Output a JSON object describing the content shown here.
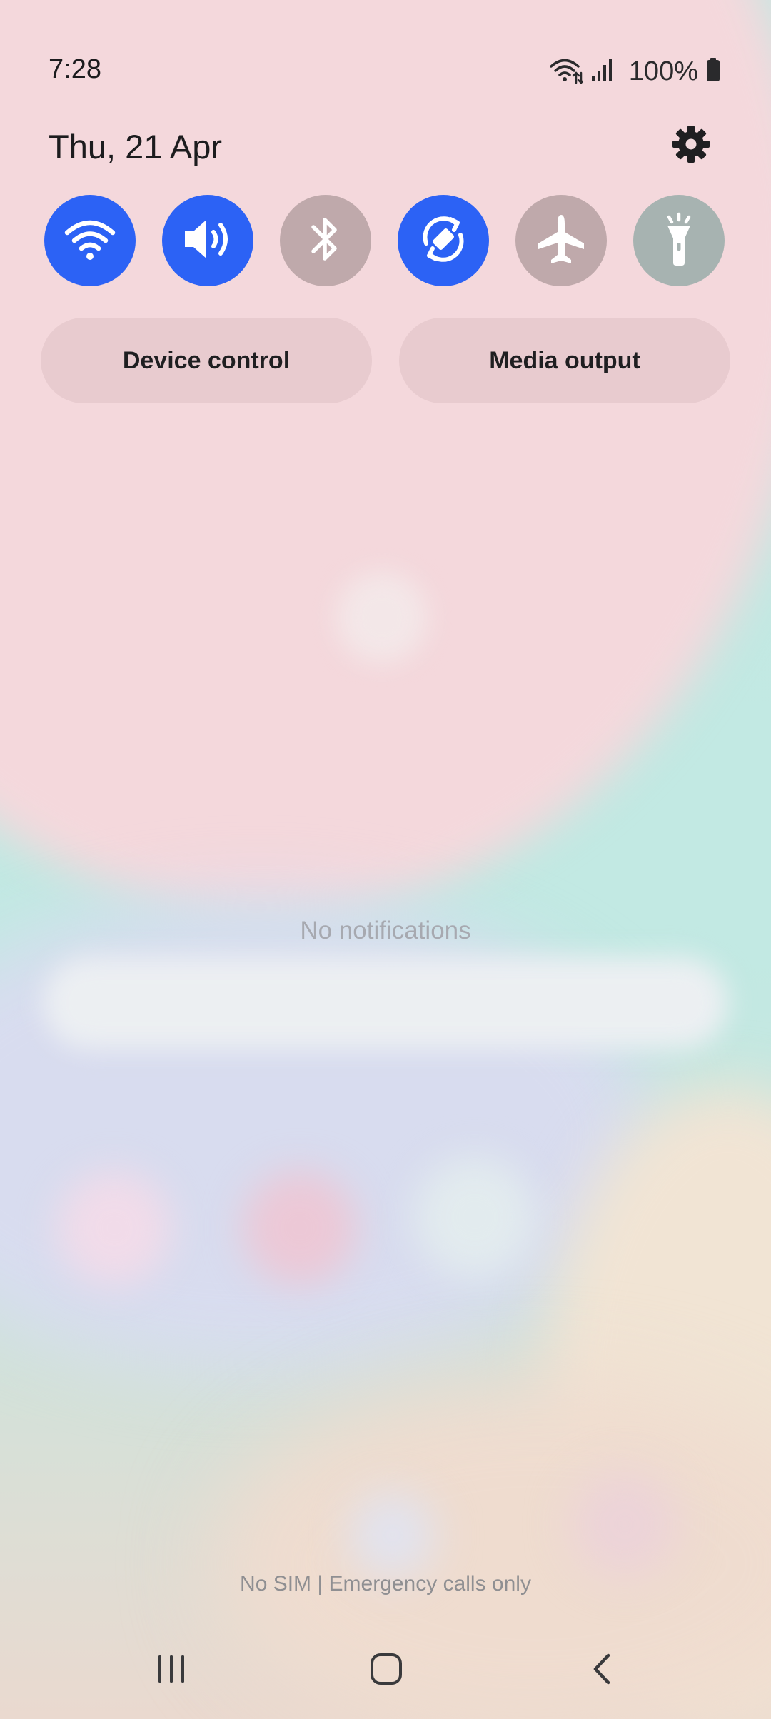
{
  "status_bar": {
    "time": "7:28",
    "battery": "100%"
  },
  "header": {
    "date": "Thu, 21 Apr"
  },
  "quick_tiles": [
    {
      "name": "wifi",
      "state": "on",
      "icon": "wifi-icon"
    },
    {
      "name": "sound",
      "state": "on",
      "icon": "speaker-icon"
    },
    {
      "name": "bluetooth",
      "state": "off",
      "icon": "bluetooth-icon"
    },
    {
      "name": "auto-rotate",
      "state": "on",
      "icon": "rotate-icon"
    },
    {
      "name": "airplane-mode",
      "state": "off",
      "icon": "airplane-icon"
    },
    {
      "name": "flashlight",
      "state": "off",
      "icon": "flashlight-icon"
    }
  ],
  "buttons": {
    "device_control": "Device control",
    "media_output": "Media output"
  },
  "notifications": {
    "empty_text": "No notifications"
  },
  "carrier": {
    "text": "No SIM | Emergency calls only"
  },
  "colors": {
    "accent_on": "#2c62f5",
    "tile_off": "#bfa9ab",
    "pill_bg": "#e8cbcf"
  }
}
